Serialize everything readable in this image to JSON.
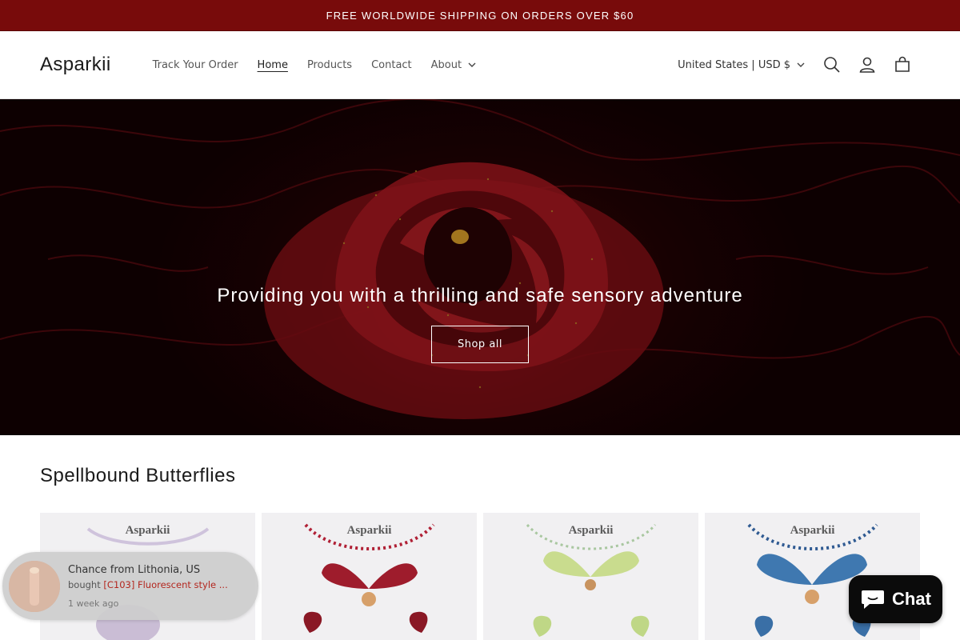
{
  "announcement": {
    "text": "FREE WORLDWIDE SHIPPING ON ORDERS OVER $60"
  },
  "header": {
    "logo": "Asparkii",
    "nav": [
      {
        "label": "Track Your Order",
        "active": false
      },
      {
        "label": "Home",
        "active": true
      },
      {
        "label": "Products",
        "active": false
      },
      {
        "label": "Contact",
        "active": false
      },
      {
        "label": "About",
        "active": false,
        "dropdown": true
      }
    ],
    "country": "United States | USD $",
    "icons": [
      "search-icon",
      "account-icon",
      "cart-icon"
    ]
  },
  "hero": {
    "title": "Providing you with a thrilling and safe sensory adventure",
    "button_label": "Shop all"
  },
  "collection": {
    "title": "Spellbound Butterflies",
    "cards": [
      {
        "brand": "Asparkii",
        "color": "#b9a6c9"
      },
      {
        "brand": "Asparkii",
        "color": "#9e1c2c"
      },
      {
        "brand": "Asparkii",
        "color": "#c9dc8e"
      },
      {
        "brand": "Asparkii",
        "color": "#3f78b0"
      }
    ]
  },
  "toast": {
    "who": "Chance from Lithonia, US",
    "bought_prefix": "bought",
    "product": "[C103] Fluorescent style ...",
    "time": "1 week ago"
  },
  "chat": {
    "label": "Chat"
  },
  "colors": {
    "announcement_bg": "#780b0b",
    "chat_bg": "#0b0b0b"
  }
}
